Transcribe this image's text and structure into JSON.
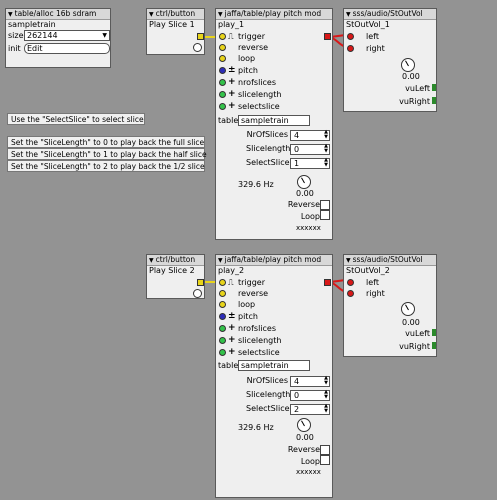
{
  "sdram": {
    "header": "table/alloc 16b sdram",
    "instance": "sampletrain",
    "size_label": "size",
    "size_value": "262144",
    "init_label": "init",
    "edit_label": "Edit"
  },
  "btn1": {
    "header": "ctrl/button",
    "instance": "Play Slice 1"
  },
  "btn2": {
    "header": "ctrl/button",
    "instance": "Play Slice 2"
  },
  "play1": {
    "header": "jaffa/table/play pitch mod",
    "instance": "play_1",
    "inlets": [
      "trigger",
      "reverse",
      "loop",
      "pitch",
      "nrofslices",
      "slicelength",
      "selectslice"
    ],
    "table_label": "table",
    "table_value": "sampletrain",
    "params": [
      {
        "label": "NrOfSlices",
        "value": "4"
      },
      {
        "label": "Slicelength",
        "value": "0"
      },
      {
        "label": "SelectSlice",
        "value": "1"
      }
    ],
    "freq": "329.6 Hz",
    "knob_value": "0.00",
    "reverse_label": "Reverse",
    "loop_label": "Loop",
    "out_label": "xxxxxx"
  },
  "play2": {
    "header": "jaffa/table/play pitch mod",
    "instance": "play_2",
    "inlets": [
      "trigger",
      "reverse",
      "loop",
      "pitch",
      "nrofslices",
      "slicelength",
      "selectslice"
    ],
    "table_label": "table",
    "table_value": "sampletrain",
    "params": [
      {
        "label": "NrOfSlices",
        "value": "4"
      },
      {
        "label": "Slicelength",
        "value": "0"
      },
      {
        "label": "SelectSlice",
        "value": "2"
      }
    ],
    "freq": "329.6 Hz",
    "knob_value": "0.00",
    "reverse_label": "Reverse",
    "loop_label": "Loop",
    "out_label": "xxxxxx"
  },
  "out1": {
    "header": "sss/audio/StOutVol",
    "instance": "StOutVol_1",
    "left": "left",
    "right": "right",
    "knob_value": "0.00",
    "vu_left": "vuLeft",
    "vu_right": "vuRight"
  },
  "out2": {
    "header": "sss/audio/StOutVol",
    "instance": "StOutVol_2",
    "left": "left",
    "right": "right",
    "knob_value": "0.00",
    "vu_left": "vuLeft",
    "vu_right": "vuRight"
  },
  "comments": [
    "Use the \"SelectSlice\" to select slice",
    "Set the \"SliceLength\" to 0 to play back the full slice",
    "Set the \"SliceLength\" to 1 to play back the half slice",
    "Set the \"SliceLength\" to 2 to play back the 1/2 slice"
  ],
  "colors": {
    "canvas": "#939393",
    "wire": "#d81818",
    "jack_yellow": "#e8d41a",
    "jack_blue": "#2c2cb8",
    "jack_green": "#33c24a",
    "jack_red": "#d81818"
  }
}
